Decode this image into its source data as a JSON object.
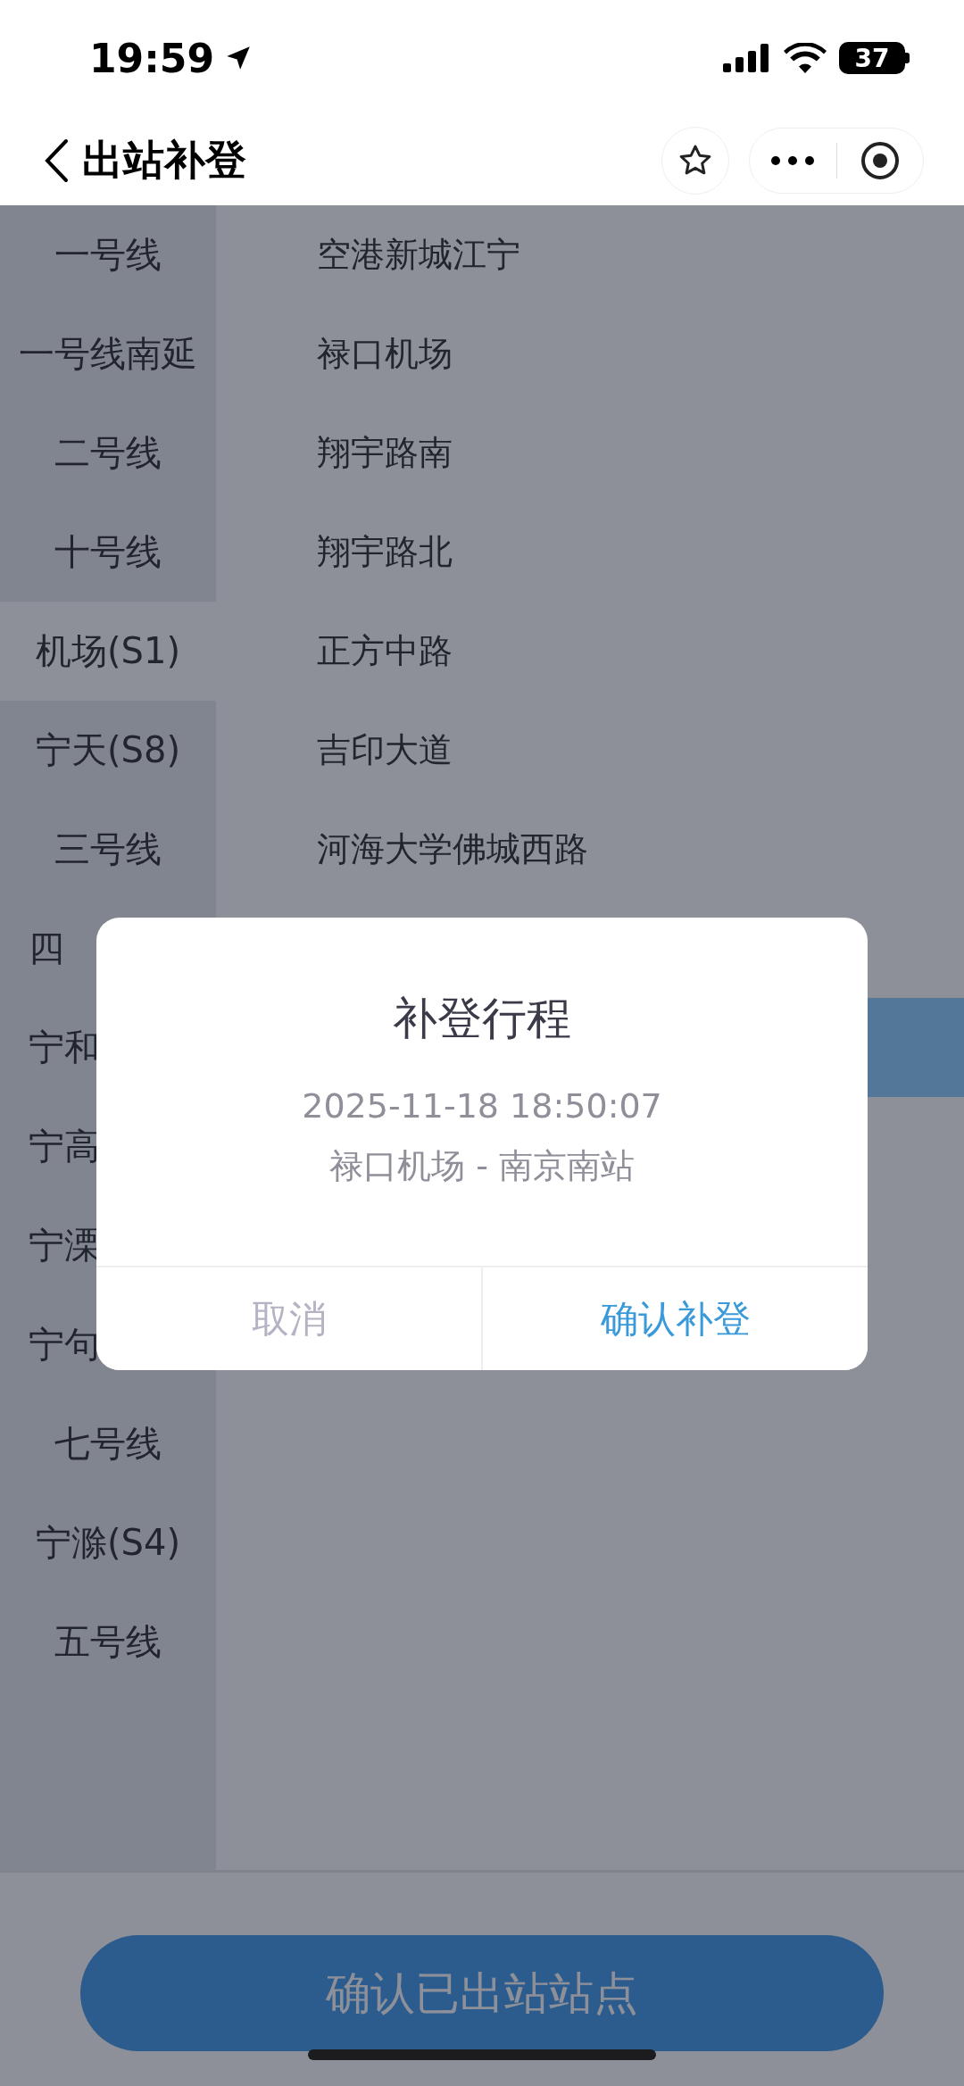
{
  "status_bar": {
    "time": "19:59",
    "battery": "37"
  },
  "nav_bar": {
    "title": "出站补登"
  },
  "lines": [
    {
      "label": "一号线",
      "selected": false,
      "kind": "full"
    },
    {
      "label": "一号线南延",
      "selected": false,
      "kind": "full"
    },
    {
      "label": "二号线",
      "selected": false,
      "kind": "full"
    },
    {
      "label": "十号线",
      "selected": false,
      "kind": "full"
    },
    {
      "label": "机场(S1)",
      "selected": true,
      "kind": "full"
    },
    {
      "label": "宁天(S8)",
      "selected": false,
      "kind": "full"
    },
    {
      "label": "三号线",
      "selected": false,
      "kind": "full"
    },
    {
      "label": "四",
      "selected": false,
      "kind": "cut"
    },
    {
      "label": "宁和",
      "selected": false,
      "kind": "cut"
    },
    {
      "label": "宁高",
      "selected": false,
      "kind": "cut"
    },
    {
      "label": "宁溧",
      "selected": false,
      "kind": "cut"
    },
    {
      "label": "宁句",
      "selected": false,
      "kind": "cut"
    },
    {
      "label": "七号线",
      "selected": false,
      "kind": "full"
    },
    {
      "label": "宁滁(S4)",
      "selected": false,
      "kind": "full"
    },
    {
      "label": "五号线",
      "selected": false,
      "kind": "full"
    }
  ],
  "stations": [
    {
      "name": "空港新城江宁",
      "selected": false
    },
    {
      "name": "禄口机场",
      "selected": false
    },
    {
      "name": "翔宇路南",
      "selected": false
    },
    {
      "name": "翔宇路北",
      "selected": false
    },
    {
      "name": "正方中路",
      "selected": false
    },
    {
      "name": "吉印大道",
      "selected": false
    },
    {
      "name": "河海大学佛城西路",
      "selected": false
    },
    {
      "selected": false
    },
    {
      "selected": true
    }
  ],
  "confirm_button": "确认已出站站点",
  "dialog": {
    "title": "补登行程",
    "time": "2025-11-18 18:50:07",
    "route": "禄口机场 - 南京南站",
    "cancel": "取消",
    "confirm": "确认补登"
  }
}
